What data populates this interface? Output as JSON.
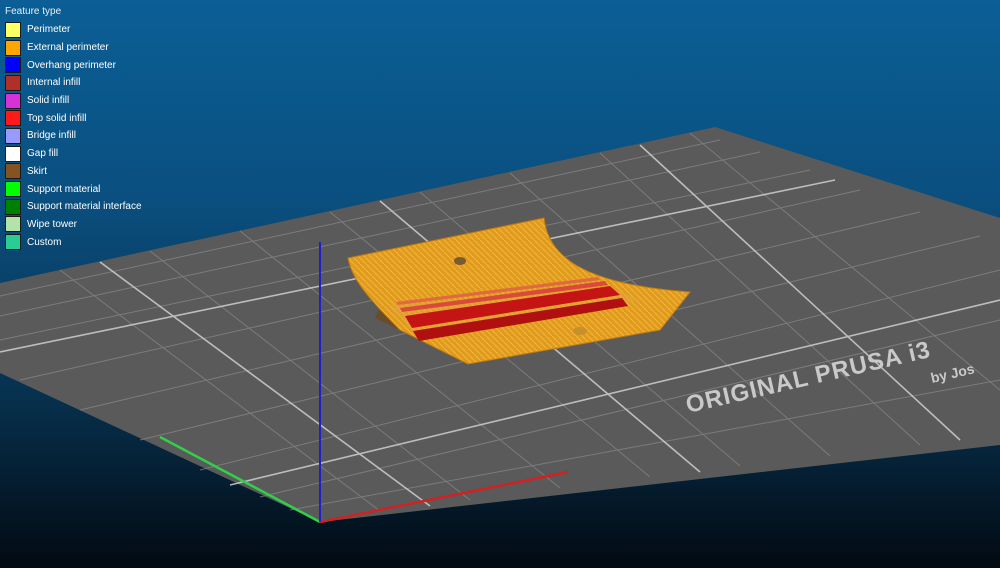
{
  "legend": {
    "title": "Feature type",
    "items": [
      {
        "label": "Perimeter",
        "color": "#ffff66"
      },
      {
        "label": "External perimeter",
        "color": "#ffa500"
      },
      {
        "label": "Overhang perimeter",
        "color": "#0000ff"
      },
      {
        "label": "Internal infill",
        "color": "#b03029"
      },
      {
        "label": "Solid infill",
        "color": "#d732d7"
      },
      {
        "label": "Top solid infill",
        "color": "#ff1a1a"
      },
      {
        "label": "Bridge infill",
        "color": "#9999ff"
      },
      {
        "label": "Gap fill",
        "color": "#ffffff"
      },
      {
        "label": "Skirt",
        "color": "#845321"
      },
      {
        "label": "Support material",
        "color": "#00ff00"
      },
      {
        "label": "Support material interface",
        "color": "#008000"
      },
      {
        "label": "Wipe tower",
        "color": "#b3e3ab"
      },
      {
        "label": "Custom",
        "color": "#28cc94"
      }
    ]
  },
  "bed": {
    "logo_text": "ORIGINAL PRUSA i3",
    "logo_subtext": "by Jos"
  }
}
